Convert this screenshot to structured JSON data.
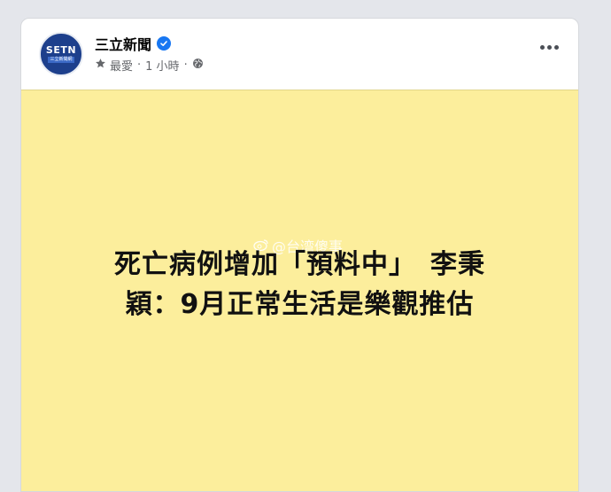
{
  "post": {
    "page_name": "三立新聞",
    "avatar_logo": "SETN",
    "avatar_sub": "三立新聞網",
    "audience": "最愛",
    "separator": "·",
    "time": "1 小時",
    "icons": {
      "verified": "verified-badge-icon",
      "star": "star-icon",
      "globe": "globe-icon",
      "more": "more-options-icon"
    }
  },
  "image": {
    "headline_line1": "死亡病例增加「預料中」　李秉",
    "headline_line2": "穎：9月正常生活是樂觀推估",
    "watermark": "@台湾傻事",
    "background": "#fcee9c"
  }
}
